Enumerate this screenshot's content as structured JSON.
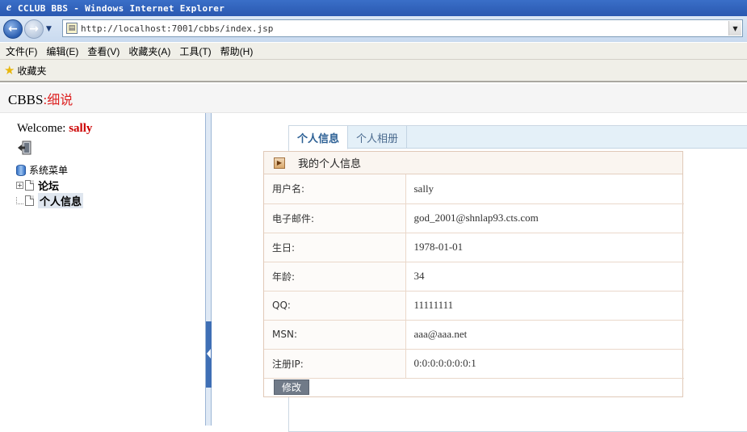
{
  "window": {
    "title": "CCLUB BBS - Windows Internet Explorer"
  },
  "browser": {
    "url": "http://localhost:7001/cbbs/index.jsp",
    "menu": [
      "文件(F)",
      "编辑(E)",
      "查看(V)",
      "收藏夹(A)",
      "工具(T)",
      "帮助(H)"
    ],
    "favorites_label": "收藏夹"
  },
  "header": {
    "brand": "CBBS",
    "separator": ":",
    "subtitle": "细说"
  },
  "sidebar": {
    "welcome_label": "Welcome:",
    "username": "sally",
    "tree_root": "系统菜单",
    "items": [
      {
        "label": "论坛"
      },
      {
        "label": "个人信息"
      }
    ]
  },
  "tabs": [
    {
      "label": "个人信息"
    },
    {
      "label": "个人相册"
    }
  ],
  "profile": {
    "title": "我的个人信息",
    "rows": [
      {
        "key": "用户名:",
        "value": "sally"
      },
      {
        "key": "电子邮件:",
        "value": "god_2001@shnlap93.cts.com"
      },
      {
        "key": "生日:",
        "value": "1978-01-01"
      },
      {
        "key": "年龄:",
        "value": "34"
      },
      {
        "key": "QQ:",
        "value": "11111111"
      },
      {
        "key": "MSN:",
        "value": "aaa@aaa.net"
      },
      {
        "key": "注册IP:",
        "value": "0:0:0:0:0:0:0:1"
      }
    ],
    "edit_label": "修改"
  }
}
